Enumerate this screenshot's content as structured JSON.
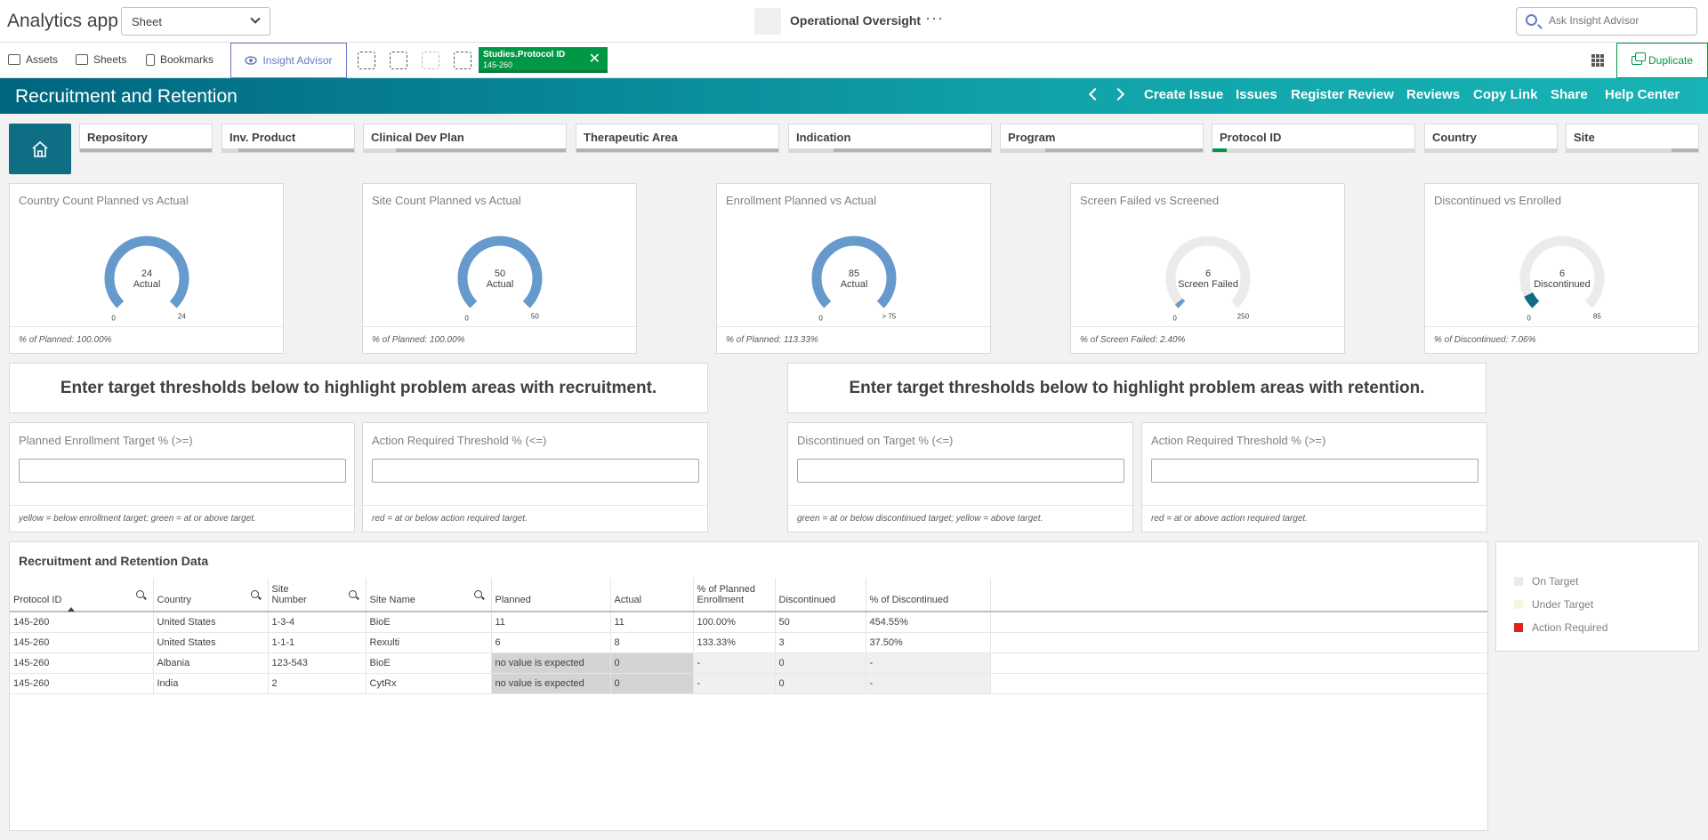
{
  "topbar": {
    "app_title": "Analytics app",
    "sheet_select": "Sheet",
    "sheet_name": "Operational Oversight",
    "more": "···",
    "search_placeholder": "Ask Insight Advisor"
  },
  "toolbar": {
    "assets": "Assets",
    "sheets": "Sheets",
    "bookmarks": "Bookmarks",
    "insight_advisor": "Insight Advisor",
    "selection_field": "Studies.Protocol ID",
    "selection_value": "145-260",
    "duplicate": "Duplicate"
  },
  "banner": {
    "title": "Recruitment and Retention",
    "links": [
      "Create Issue",
      "Issues",
      "Register Review",
      "Reviews",
      "Copy Link",
      "Share",
      "Help Center"
    ]
  },
  "filters": [
    "Repository",
    "Inv. Product",
    "Clinical Dev Plan",
    "Therapeutic Area",
    "Indication",
    "Program",
    "Protocol ID",
    "Country",
    "Site"
  ],
  "kpis": [
    {
      "title": "Country Count Planned vs Actual",
      "value": "24",
      "label": "Actual",
      "min": "0",
      "max": "24",
      "fraction": 1.0,
      "footer": "% of Planned: 100.00%",
      "color": "#6699cc"
    },
    {
      "title": "Site Count Planned vs Actual",
      "value": "50",
      "label": "Actual",
      "min": "0",
      "max": "50",
      "fraction": 1.0,
      "footer": "% of Planned: 100.00%",
      "color": "#6699cc"
    },
    {
      "title": "Enrollment Planned vs Actual",
      "value": "85",
      "label": "Actual",
      "min": "0",
      "max": "75",
      "fraction": 1.0,
      "footer": "% of Planned: 113.33%",
      "color": "#6699cc",
      "overflow": ">"
    },
    {
      "title": "Screen Failed vs Screened",
      "value": "6",
      "label": "Screen Failed",
      "min": "0",
      "max": "250",
      "fraction": 0.024,
      "footer": "% of Screen Failed: 2.40%",
      "color": "#6699cc"
    },
    {
      "title": "Discontinued vs Enrolled",
      "value": "6",
      "label": "Discontinued",
      "min": "0",
      "max": "85",
      "fraction": 0.0706,
      "footer": "% of Discontinued: 7.06%",
      "color": "#0f6e83"
    }
  ],
  "threshold_titles": {
    "recruitment": "Enter target thresholds below to highlight problem areas with recruitment.",
    "retention": "Enter target thresholds below to highlight problem areas with retention."
  },
  "inputs": [
    {
      "title": "Planned Enrollment Target % (>=)",
      "footer": "yellow = below enrollment target; green = at or above target."
    },
    {
      "title": "Action Required Threshold % (<=)",
      "footer": "red = at or below action required target."
    },
    {
      "title": "Discontinued on Target % (<=)",
      "footer": "green = at or below discontinued target; yellow = above target."
    },
    {
      "title": "Action Required Threshold % (>=)",
      "footer": "red = at or above action required target."
    }
  ],
  "table": {
    "title": "Recruitment and Retention Data",
    "headers": [
      "Protocol ID",
      "Country",
      "Site Number",
      "Site Name",
      "Planned",
      "Actual",
      "% of Planned Enrollment",
      "Discontinued",
      "% of Discontinued"
    ],
    "rows": [
      [
        "145-260",
        "United States",
        "1-3-4",
        "BioE",
        "11",
        "11",
        "100.00%",
        "50",
        "454.55%"
      ],
      [
        "145-260",
        "United States",
        "1-1-1",
        "Rexulti",
        "6",
        "8",
        "133.33%",
        "3",
        "37.50%"
      ],
      [
        "145-260",
        "Albania",
        "123-543",
        "BioE",
        "no value is expected",
        "0",
        "-",
        "0",
        "-"
      ],
      [
        "145-260",
        "India",
        "2",
        "CytRx",
        "no value is expected",
        "0",
        "-",
        "0",
        "-"
      ]
    ]
  },
  "legend": [
    {
      "label": "On Target",
      "color": "#e6ece6"
    },
    {
      "label": "Under Target",
      "color": "#f7f7df"
    },
    {
      "label": "Action Required",
      "color": "#d9251c"
    }
  ]
}
